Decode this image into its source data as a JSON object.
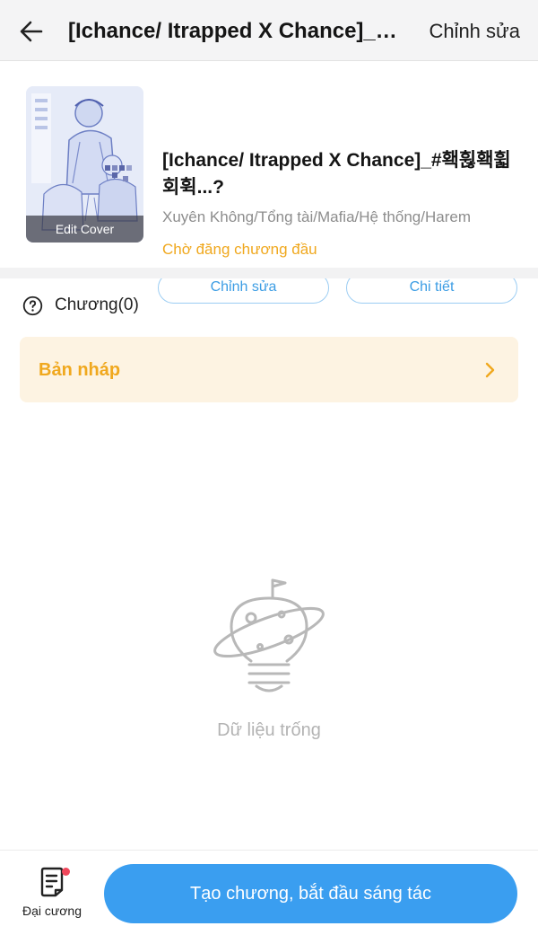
{
  "header": {
    "back_icon": "arrow-left-icon",
    "title": "[Ichance/ Itrapped X Chance]_#홱휞홱휣회휙",
    "edit_label": "Chỉnh sửa"
  },
  "book": {
    "cover_label": "Edit Cover",
    "title": "[Ichance/ Itrapped X Chance]_#홱휞홱휣회휙...?",
    "tags": "Xuyên Không/Tổng tài/Mafia/Hệ thống/Harem",
    "status": "Chờ đăng chương đầu",
    "edit_button": "Chỉnh sửa",
    "detail_button": "Chi tiết"
  },
  "chapters": {
    "icon": "question-circle-icon",
    "label": "Chương(0)"
  },
  "draft": {
    "label": "Bản nháp",
    "icon": "chevron-right-icon"
  },
  "empty": {
    "icon": "planet-lightbulb-icon",
    "text": "Dữ liệu trống"
  },
  "bottom": {
    "outline_icon": "document-list-icon",
    "outline_label": "Đại cương",
    "create_label": "Tạo chương, bắt đầu sáng tác"
  },
  "colors": {
    "accent_blue": "#3a9ef0",
    "accent_orange": "#f0a81e",
    "draft_bg": "#fdf3e2",
    "notification_red": "#f0475b"
  }
}
